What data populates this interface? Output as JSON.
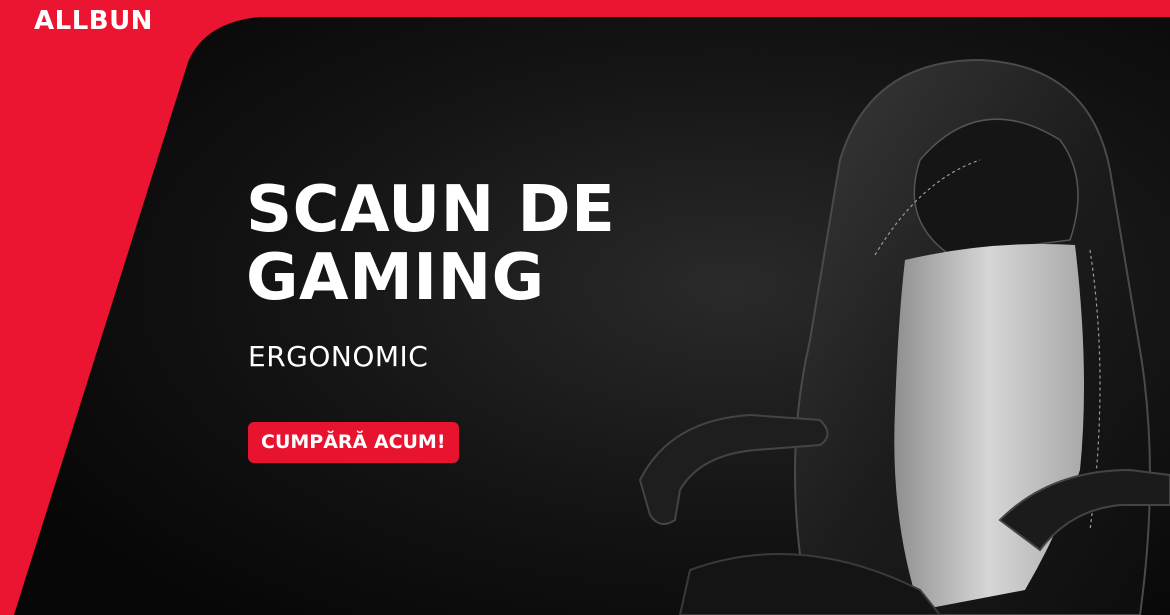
{
  "brand": {
    "logo_text": "ALLBUN"
  },
  "hero": {
    "headline_line1": "SCAUN DE",
    "headline_line2": "GAMING",
    "subtitle": "ERGONOMIC",
    "cta_label": "CUMPĂRĂ ACUM!"
  },
  "colors": {
    "brand_red": "#ec1531",
    "background_dark": "#0c0c0c",
    "text": "#ffffff"
  },
  "images": {
    "product": "gaming-chair"
  }
}
